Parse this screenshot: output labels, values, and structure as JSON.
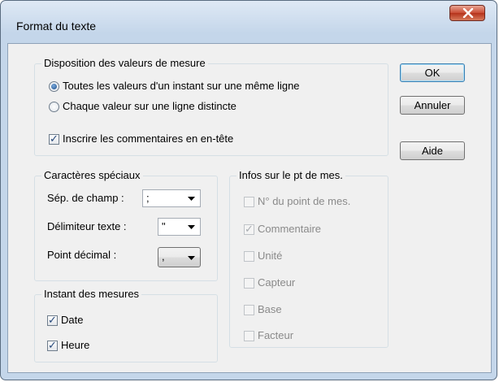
{
  "window": {
    "title": "Format du texte"
  },
  "disposition": {
    "legend": "Disposition des valeurs de mesure",
    "option_same_line": "Toutes les valeurs d'un instant sur une même ligne",
    "option_separate_line": "Chaque valeur sur une ligne distincte",
    "selected": "same_line",
    "comments_header": "Inscrire les commentaires en en-tête",
    "comments_header_checked": true
  },
  "special_chars": {
    "legend": "Caractères spéciaux",
    "field_sep_label": "Sép. de champ :",
    "field_sep_value": ";",
    "text_delim_label": "Délimiteur texte :",
    "text_delim_value": "\"",
    "decimal_label": "Point décimal :",
    "decimal_value": ","
  },
  "instant": {
    "legend": "Instant des mesures",
    "date_label": "Date",
    "date_checked": true,
    "time_label": "Heure",
    "time_checked": true
  },
  "measure_info": {
    "legend": "Infos sur le pt de mes.",
    "items": [
      {
        "label": "N° du point de mes.",
        "checked": false
      },
      {
        "label": "Commentaire",
        "checked": true
      },
      {
        "label": "Unité",
        "checked": false
      },
      {
        "label": "Capteur",
        "checked": false
      },
      {
        "label": "Base",
        "checked": false
      },
      {
        "label": "Facteur",
        "checked": false
      }
    ]
  },
  "buttons": {
    "ok": "OK",
    "cancel": "Annuler",
    "help": "Aide"
  }
}
